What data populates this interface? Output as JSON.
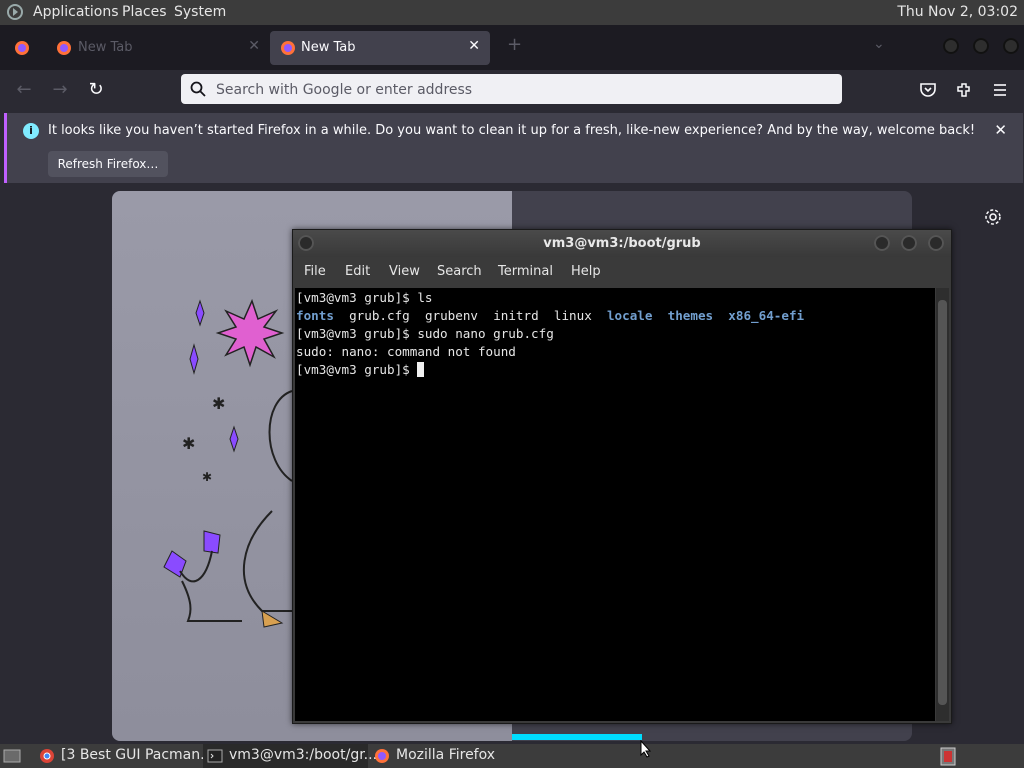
{
  "panel": {
    "menus": [
      "Applications",
      "Places",
      "System"
    ],
    "clock": "Thu Nov  2, 03:02"
  },
  "browser": {
    "tabs": [
      {
        "title": "New Tab",
        "active": false
      },
      {
        "title": "New Tab",
        "active": true
      }
    ],
    "urlbar_placeholder": "Search with Google or enter address",
    "notification": {
      "message": "It looks like you haven’t started Firefox in a while. Do you want to clean it up for a fresh, like-new experience? And by the way, welcome back!",
      "button": "Refresh Firefox…"
    }
  },
  "terminal": {
    "title": "vm3@vm3:/boot/grub",
    "menu": [
      "File",
      "Edit",
      "View",
      "Search",
      "Terminal",
      "Help"
    ],
    "lines": {
      "l1": "[vm3@vm3 grub]$ ls",
      "l2_files": [
        "fonts",
        "grub.cfg",
        "grubenv",
        "initrd",
        "linux",
        "locale",
        "themes",
        "x86_64-efi"
      ],
      "l3": "[vm3@vm3 grub]$ sudo nano grub.cfg",
      "l4": "sudo: nano: command not found",
      "l5": "[vm3@vm3 grub]$ "
    }
  },
  "taskbar": {
    "items": [
      {
        "label": "[3 Best GUI Pacman..."
      },
      {
        "label": "vm3@vm3:/boot/gr..."
      },
      {
        "label": "Mozilla Firefox"
      }
    ]
  },
  "colors": {
    "accent": "#00ddff",
    "notif_border": "#c060ff",
    "dir": "#729fcf"
  }
}
